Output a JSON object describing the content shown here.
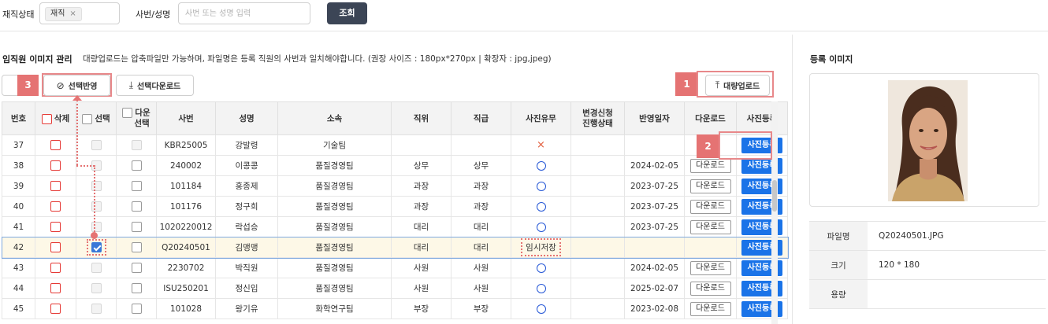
{
  "filters": {
    "status_label": "재직상태",
    "status_tag": "재직",
    "status_tag_remove": "×",
    "empno_label": "사번/성명",
    "search_placeholder": "사번 또는 성명 입력",
    "search_button": "조회"
  },
  "panel": {
    "title": "임직원 이미지 관리",
    "description": "대량업로드는 압축파일만 가능하며, 파일명은 등록 직원의 사번과 일치해야합니다. (권장 사이즈 : 180px*270px | 확장자 : jpg,jpeg)",
    "apply_button": "선택반영",
    "download_button": "선택다운로드",
    "bulk_upload_button": "대량업로드"
  },
  "callouts": {
    "one": "1",
    "two": "2",
    "three": "3"
  },
  "table": {
    "headers": {
      "no": "번호",
      "delete": "삭제",
      "select": "선택",
      "dl_select_1": "다운",
      "dl_select_2": "선택",
      "empno": "사번",
      "name": "성명",
      "dept": "소속",
      "position": "직위",
      "rank": "직급",
      "photo": "사진유무",
      "change_1": "변경신청",
      "change_2": "진행상태",
      "applied": "반영일자",
      "download": "다운로드",
      "register": "사진등록"
    },
    "download_label": "다운로드",
    "register_label": "사진등록",
    "rows": [
      {
        "no": "37",
        "empno": "KBR25005",
        "name": "강발령",
        "dept": "기술팀",
        "position": "",
        "rank": "",
        "photo": "×",
        "applied": ""
      },
      {
        "no": "38",
        "empno": "240002",
        "name": "이콩콩",
        "dept": "품질경영팀",
        "position": "상무",
        "rank": "상무",
        "photo": "o",
        "applied": "2024-02-05"
      },
      {
        "no": "39",
        "empno": "101184",
        "name": "홍종제",
        "dept": "품질경영팀",
        "position": "과장",
        "rank": "과장",
        "photo": "o",
        "applied": "2023-07-25"
      },
      {
        "no": "40",
        "empno": "101176",
        "name": "정구희",
        "dept": "품질경영팀",
        "position": "과장",
        "rank": "과장",
        "photo": "o",
        "applied": "2023-07-25"
      },
      {
        "no": "41",
        "empno": "1020220012",
        "name": "락섭승",
        "dept": "품질경영팀",
        "position": "대리",
        "rank": "대리",
        "photo": "o",
        "applied": "2023-07-25"
      },
      {
        "no": "42",
        "empno": "Q20240501",
        "name": "김맹맹",
        "dept": "품질경영팀",
        "position": "대리",
        "rank": "대리",
        "photo": "임시저장",
        "applied": ""
      },
      {
        "no": "43",
        "empno": "2230702",
        "name": "박직원",
        "dept": "품질경영팀",
        "position": "사원",
        "rank": "사원",
        "photo": "o",
        "applied": "2024-02-05"
      },
      {
        "no": "44",
        "empno": "ISU250201",
        "name": "정신입",
        "dept": "품질경영팀",
        "position": "사원",
        "rank": "사원",
        "photo": "o",
        "applied": "2025-02-07"
      },
      {
        "no": "45",
        "empno": "101028",
        "name": "왕기유",
        "dept": "화학연구팀",
        "position": "부장",
        "rank": "부장",
        "photo": "o",
        "applied": "2023-02-08"
      }
    ]
  },
  "image_panel": {
    "title": "등록 이미지",
    "filename_label": "파일명",
    "filename": "Q20240501.JPG",
    "size_label": "크기",
    "size": "120 * 180",
    "volume_label": "용량",
    "volume": ""
  },
  "colors": {
    "accent_blue": "#1a73e8",
    "callout_red": "#e57373",
    "search_button": "#3c4556"
  }
}
